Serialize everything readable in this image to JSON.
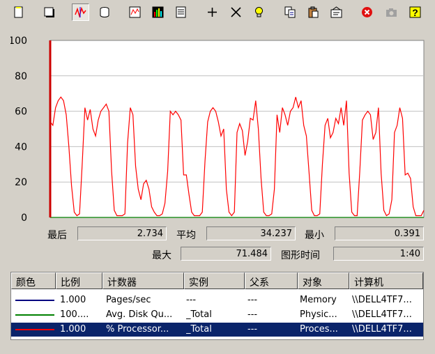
{
  "toolbar": {
    "buttons": [
      {
        "icon": "new-counter-set-icon",
        "pressed": false
      },
      {
        "icon": "clear-display-icon",
        "pressed": false
      },
      {
        "icon": "view-current-activity-icon",
        "pressed": true
      },
      {
        "icon": "view-log-data-icon",
        "pressed": false
      },
      {
        "icon": "view-graph-icon",
        "pressed": false
      },
      {
        "icon": "view-histogram-icon",
        "pressed": false
      },
      {
        "icon": "view-report-icon",
        "pressed": false
      },
      {
        "icon": "add-icon",
        "pressed": false
      },
      {
        "icon": "delete-icon",
        "pressed": false
      },
      {
        "icon": "highlight-icon",
        "pressed": false
      },
      {
        "icon": "copy-properties-icon",
        "pressed": false
      },
      {
        "icon": "paste-counter-list-icon",
        "pressed": false
      },
      {
        "icon": "properties-icon",
        "pressed": false
      },
      {
        "icon": "freeze-display-icon",
        "pressed": false
      },
      {
        "icon": "update-data-icon",
        "pressed": false
      },
      {
        "icon": "help-icon",
        "pressed": false
      }
    ]
  },
  "chart_data": {
    "type": "line",
    "ylim": [
      0,
      100
    ],
    "yticks": [
      "100",
      "80",
      "60",
      "40",
      "20",
      "0"
    ],
    "grid": true,
    "series": [
      {
        "color": "#ff0000",
        "values": [
          54,
          52,
          62,
          66,
          68,
          66,
          58,
          40,
          18,
          3,
          1,
          2,
          30,
          62,
          55,
          61,
          50,
          46,
          55,
          60,
          62,
          64,
          60,
          26,
          4,
          1,
          1,
          1,
          2,
          42,
          62,
          58,
          29,
          16,
          10,
          19,
          21,
          16,
          6,
          3,
          1,
          1,
          2,
          8,
          26,
          60,
          58,
          60,
          58,
          55,
          24,
          24,
          13,
          3,
          1,
          1,
          1,
          3,
          32,
          54,
          60,
          62,
          60,
          54,
          46,
          50,
          16,
          3,
          1,
          3,
          48,
          53,
          49,
          35,
          43,
          56,
          55,
          66,
          50,
          22,
          3,
          1,
          1,
          2,
          16,
          58,
          48,
          62,
          58,
          52,
          60,
          62,
          68,
          62,
          66,
          52,
          46,
          25,
          4,
          1,
          1,
          2,
          30,
          52,
          56,
          45,
          48,
          56,
          53,
          62,
          52,
          66,
          25,
          3,
          1,
          1,
          26,
          55,
          58,
          60,
          58,
          44,
          48,
          62,
          25,
          4,
          1,
          2,
          10,
          48,
          52,
          62,
          56,
          24,
          25,
          22,
          6,
          1,
          1,
          1,
          4
        ]
      },
      {
        "color": "#008000",
        "values": [
          0,
          0
        ]
      }
    ]
  },
  "stats": {
    "last_label": "最后",
    "last_value": "2.734",
    "avg_label": "平均",
    "avg_value": "34.237",
    "min_label": "最小",
    "min_value": "0.391",
    "max_label": "最大",
    "max_value": "71.484",
    "duration_label": "图形时间",
    "duration_value": "1:40"
  },
  "legend": {
    "columns": [
      "颜色",
      "比例",
      "计数器",
      "实例",
      "父系",
      "对象",
      "计算机"
    ],
    "rows": [
      {
        "color": "#000080",
        "scale": "1.000",
        "counter": "Pages/sec",
        "instance": "---",
        "parent": "---",
        "object": "Memory",
        "computer": "\\\\DELL4TF7..."
      },
      {
        "color": "#008000",
        "scale": "100....",
        "counter": "Avg. Disk Qu...",
        "instance": "_Total",
        "parent": "---",
        "object": "Physic...",
        "computer": "\\\\DELL4TF7..."
      },
      {
        "color": "#ff0000",
        "scale": "1.000",
        "counter": "% Processor...",
        "instance": "_Total",
        "parent": "---",
        "object": "Proces...",
        "computer": "\\\\DELL4TF7..."
      }
    ]
  }
}
